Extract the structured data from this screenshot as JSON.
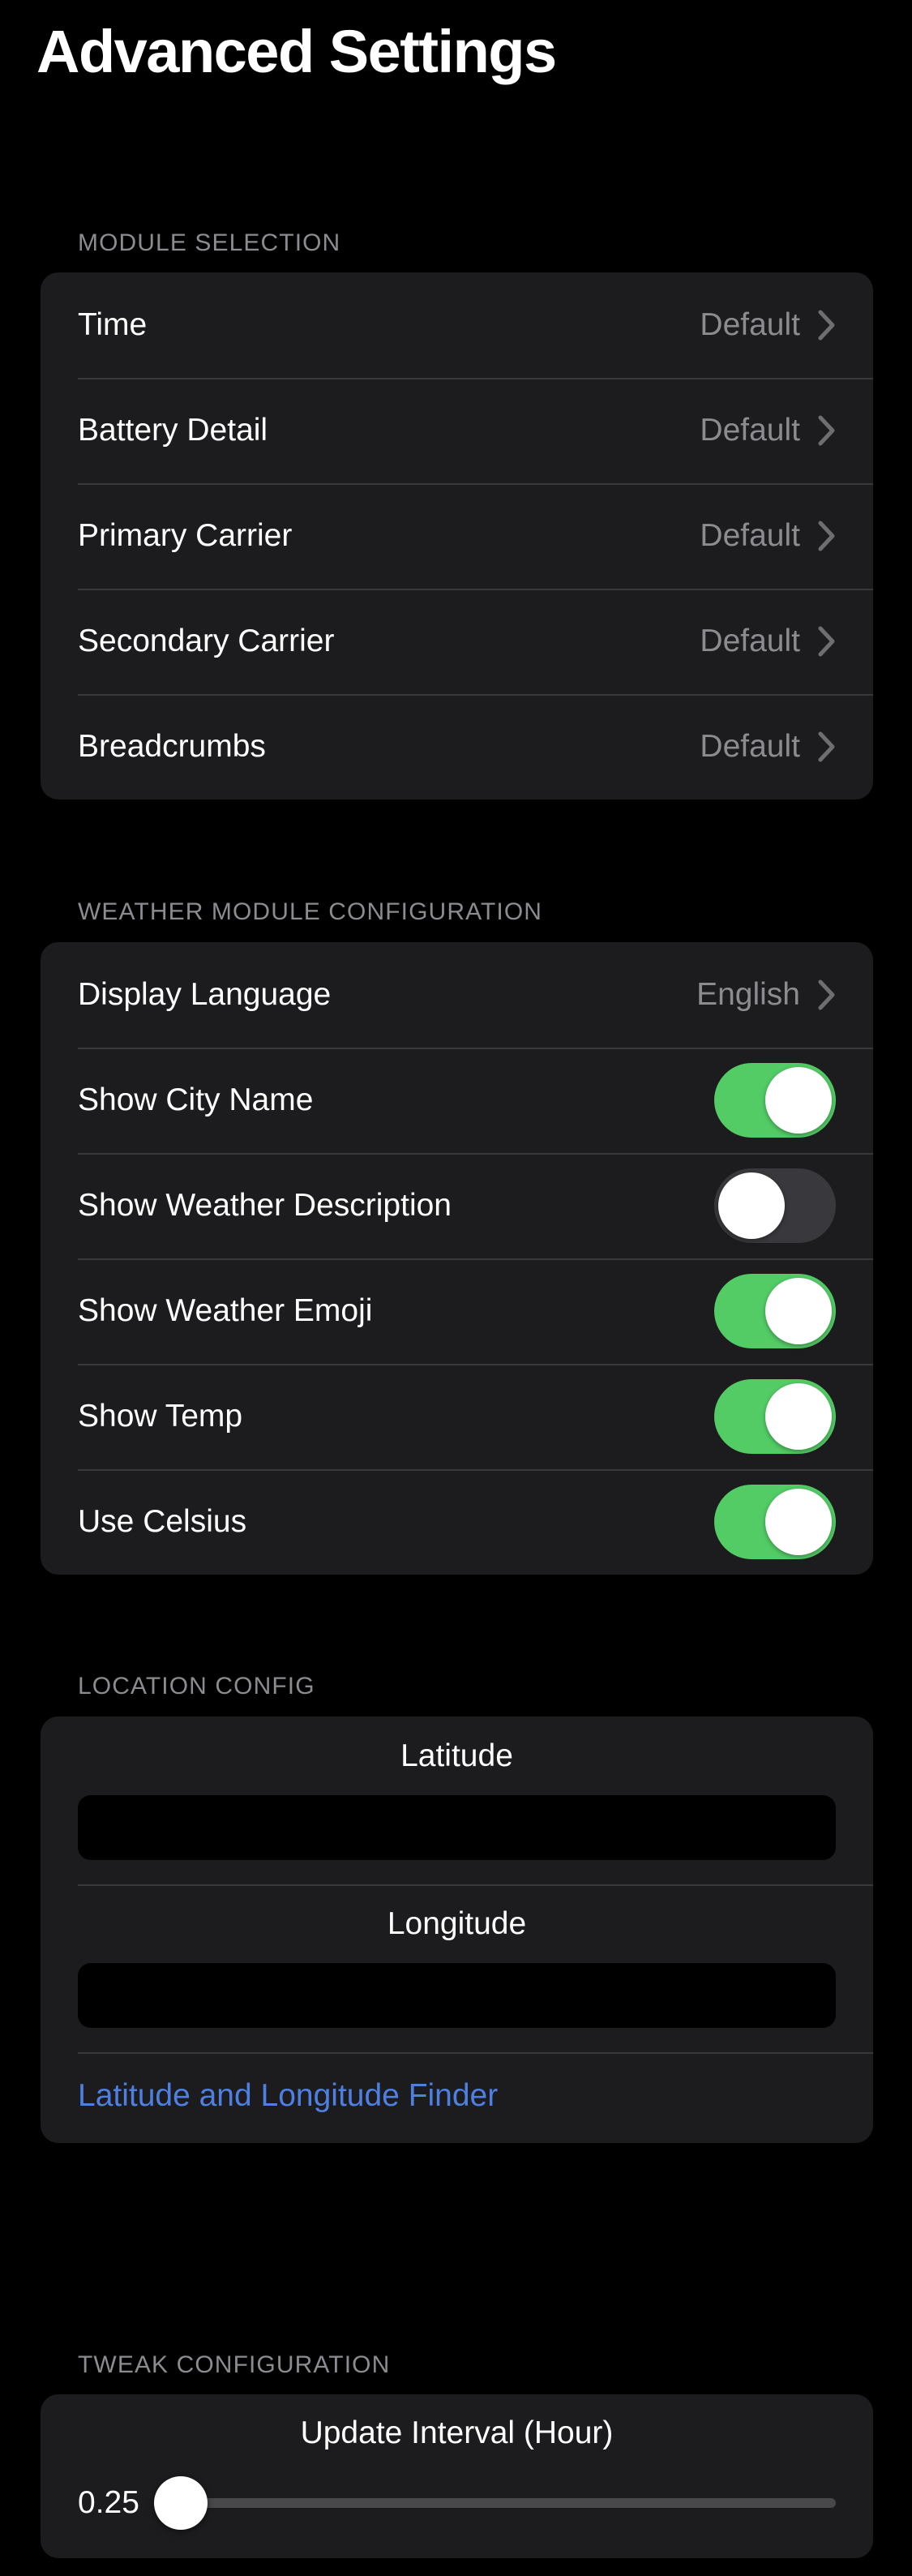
{
  "page": {
    "title": "Advanced Settings",
    "background_color": "#000000",
    "card_color": "#1c1c1e",
    "accent_green": "#53cc66",
    "accent_blue": "#4f7fe0",
    "muted_text_color": "#8b8b90"
  },
  "sections": {
    "module_selection": {
      "header": "MODULE SELECTION",
      "rows": [
        {
          "label": "Time",
          "value": "Default",
          "disclosure": "chevron-right-icon"
        },
        {
          "label": "Battery Detail",
          "value": "Default",
          "disclosure": "chevron-right-icon"
        },
        {
          "label": "Primary Carrier",
          "value": "Default",
          "disclosure": "chevron-right-icon"
        },
        {
          "label": "Secondary Carrier",
          "value": "Default",
          "disclosure": "chevron-right-icon"
        },
        {
          "label": "Breadcrumbs",
          "value": "Default",
          "disclosure": "chevron-right-icon"
        }
      ]
    },
    "weather_module_configuration": {
      "header": "WEATHER MODULE CONFIGURATION",
      "language_row": {
        "label": "Display Language",
        "value": "English",
        "disclosure": "chevron-right-icon"
      },
      "toggles": [
        {
          "label": "Show City Name",
          "state": "on"
        },
        {
          "label": "Show Weather Description",
          "state": "off"
        },
        {
          "label": "Show Weather Emoji",
          "state": "on"
        },
        {
          "label": "Show Temp",
          "state": "on"
        },
        {
          "label": "Use Celsius",
          "state": "on"
        }
      ]
    },
    "location_config": {
      "header": "LOCATION CONFIG",
      "latitude": {
        "label": "Latitude",
        "value": "",
        "placeholder": ""
      },
      "longitude": {
        "label": "Longitude",
        "value": "",
        "placeholder": ""
      },
      "link": "Latitude and Longitude Finder"
    },
    "tweak_configuration": {
      "header": "TWEAK CONFIGURATION",
      "slider": {
        "title": "Update Interval (Hour)",
        "value": "0.25",
        "fill_percent": 0
      }
    }
  }
}
